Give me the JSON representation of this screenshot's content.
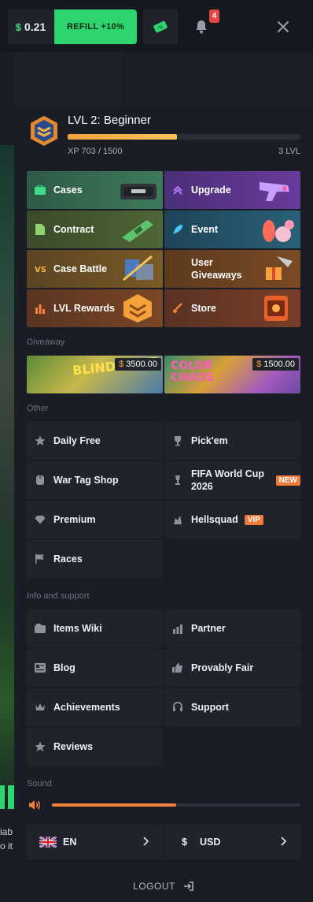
{
  "topbar": {
    "balance_currency": "$",
    "balance_value": "0.21",
    "refill_label": "REFILL +10%",
    "notifications_count": "4"
  },
  "background": {
    "snippet_line1": "iab",
    "snippet_line2": "o it"
  },
  "level": {
    "title": "LVL 2: Beginner",
    "xp_text": "XP 703 / 1500",
    "next_level": "3 LVL",
    "progress": 0.47
  },
  "main_tiles": [
    {
      "label": "Cases"
    },
    {
      "label": "Upgrade"
    },
    {
      "label": "Contract"
    },
    {
      "label": "Event"
    },
    {
      "label": "Case Battle"
    },
    {
      "label": "User Giveaways"
    },
    {
      "label": "LVL Rewards"
    },
    {
      "label": "Store"
    }
  ],
  "giveaway": {
    "section_label": "Giveaway",
    "items": [
      {
        "title": "BLIND SPOT",
        "price": "3500.00",
        "currency": "$"
      },
      {
        "title": "COLOR CHAOS",
        "price": "1500.00",
        "currency": "$"
      }
    ]
  },
  "other": {
    "section_label": "Other",
    "items": [
      {
        "label": "Daily Free"
      },
      {
        "label": "Pick'em"
      },
      {
        "label": "War Tag Shop"
      },
      {
        "label": "FIFA World Cup 2026",
        "tag": "NEW"
      },
      {
        "label": "Premium"
      },
      {
        "label": "Hellsquad",
        "tag": "VIP"
      },
      {
        "label": "Races"
      }
    ]
  },
  "info": {
    "section_label": "Info and support",
    "items": [
      {
        "label": "Items Wiki"
      },
      {
        "label": "Partner"
      },
      {
        "label": "Blog"
      },
      {
        "label": "Provably Fair"
      },
      {
        "label": "Achievements"
      },
      {
        "label": "Support"
      },
      {
        "label": "Reviews"
      }
    ]
  },
  "sound": {
    "section_label": "Sound",
    "volume": 0.5
  },
  "language": {
    "value": "EN"
  },
  "currency": {
    "symbol": "$",
    "value": "USD"
  },
  "logout_label": "LOGOUT",
  "colors": {
    "accent_green": "#2ed46d",
    "accent_orange": "#f6833c",
    "badge_red": "#e74545"
  }
}
